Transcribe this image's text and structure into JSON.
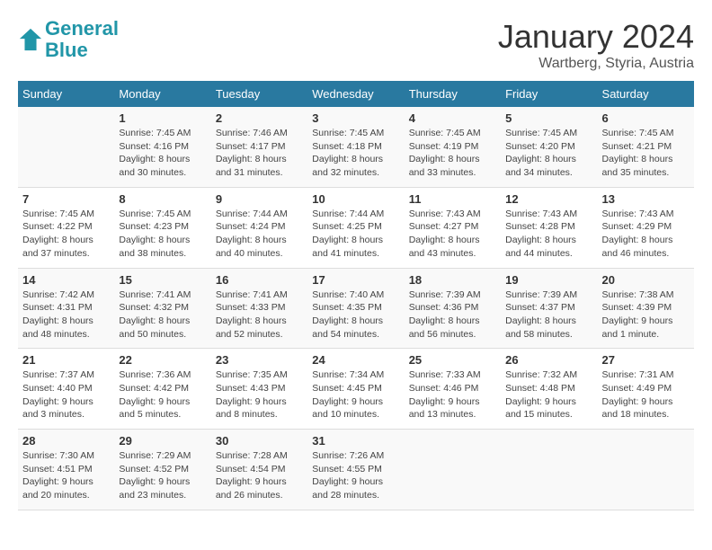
{
  "logo": {
    "line1": "General",
    "line2": "Blue"
  },
  "title": "January 2024",
  "location": "Wartberg, Styria, Austria",
  "weekdays": [
    "Sunday",
    "Monday",
    "Tuesday",
    "Wednesday",
    "Thursday",
    "Friday",
    "Saturday"
  ],
  "weeks": [
    [
      {
        "day": "",
        "sunrise": "",
        "sunset": "",
        "daylight": ""
      },
      {
        "day": "1",
        "sunrise": "Sunrise: 7:45 AM",
        "sunset": "Sunset: 4:16 PM",
        "daylight": "Daylight: 8 hours and 30 minutes."
      },
      {
        "day": "2",
        "sunrise": "Sunrise: 7:46 AM",
        "sunset": "Sunset: 4:17 PM",
        "daylight": "Daylight: 8 hours and 31 minutes."
      },
      {
        "day": "3",
        "sunrise": "Sunrise: 7:45 AM",
        "sunset": "Sunset: 4:18 PM",
        "daylight": "Daylight: 8 hours and 32 minutes."
      },
      {
        "day": "4",
        "sunrise": "Sunrise: 7:45 AM",
        "sunset": "Sunset: 4:19 PM",
        "daylight": "Daylight: 8 hours and 33 minutes."
      },
      {
        "day": "5",
        "sunrise": "Sunrise: 7:45 AM",
        "sunset": "Sunset: 4:20 PM",
        "daylight": "Daylight: 8 hours and 34 minutes."
      },
      {
        "day": "6",
        "sunrise": "Sunrise: 7:45 AM",
        "sunset": "Sunset: 4:21 PM",
        "daylight": "Daylight: 8 hours and 35 minutes."
      }
    ],
    [
      {
        "day": "7",
        "sunrise": "Sunrise: 7:45 AM",
        "sunset": "Sunset: 4:22 PM",
        "daylight": "Daylight: 8 hours and 37 minutes."
      },
      {
        "day": "8",
        "sunrise": "Sunrise: 7:45 AM",
        "sunset": "Sunset: 4:23 PM",
        "daylight": "Daylight: 8 hours and 38 minutes."
      },
      {
        "day": "9",
        "sunrise": "Sunrise: 7:44 AM",
        "sunset": "Sunset: 4:24 PM",
        "daylight": "Daylight: 8 hours and 40 minutes."
      },
      {
        "day": "10",
        "sunrise": "Sunrise: 7:44 AM",
        "sunset": "Sunset: 4:25 PM",
        "daylight": "Daylight: 8 hours and 41 minutes."
      },
      {
        "day": "11",
        "sunrise": "Sunrise: 7:43 AM",
        "sunset": "Sunset: 4:27 PM",
        "daylight": "Daylight: 8 hours and 43 minutes."
      },
      {
        "day": "12",
        "sunrise": "Sunrise: 7:43 AM",
        "sunset": "Sunset: 4:28 PM",
        "daylight": "Daylight: 8 hours and 44 minutes."
      },
      {
        "day": "13",
        "sunrise": "Sunrise: 7:43 AM",
        "sunset": "Sunset: 4:29 PM",
        "daylight": "Daylight: 8 hours and 46 minutes."
      }
    ],
    [
      {
        "day": "14",
        "sunrise": "Sunrise: 7:42 AM",
        "sunset": "Sunset: 4:31 PM",
        "daylight": "Daylight: 8 hours and 48 minutes."
      },
      {
        "day": "15",
        "sunrise": "Sunrise: 7:41 AM",
        "sunset": "Sunset: 4:32 PM",
        "daylight": "Daylight: 8 hours and 50 minutes."
      },
      {
        "day": "16",
        "sunrise": "Sunrise: 7:41 AM",
        "sunset": "Sunset: 4:33 PM",
        "daylight": "Daylight: 8 hours and 52 minutes."
      },
      {
        "day": "17",
        "sunrise": "Sunrise: 7:40 AM",
        "sunset": "Sunset: 4:35 PM",
        "daylight": "Daylight: 8 hours and 54 minutes."
      },
      {
        "day": "18",
        "sunrise": "Sunrise: 7:39 AM",
        "sunset": "Sunset: 4:36 PM",
        "daylight": "Daylight: 8 hours and 56 minutes."
      },
      {
        "day": "19",
        "sunrise": "Sunrise: 7:39 AM",
        "sunset": "Sunset: 4:37 PM",
        "daylight": "Daylight: 8 hours and 58 minutes."
      },
      {
        "day": "20",
        "sunrise": "Sunrise: 7:38 AM",
        "sunset": "Sunset: 4:39 PM",
        "daylight": "Daylight: 9 hours and 1 minute."
      }
    ],
    [
      {
        "day": "21",
        "sunrise": "Sunrise: 7:37 AM",
        "sunset": "Sunset: 4:40 PM",
        "daylight": "Daylight: 9 hours and 3 minutes."
      },
      {
        "day": "22",
        "sunrise": "Sunrise: 7:36 AM",
        "sunset": "Sunset: 4:42 PM",
        "daylight": "Daylight: 9 hours and 5 minutes."
      },
      {
        "day": "23",
        "sunrise": "Sunrise: 7:35 AM",
        "sunset": "Sunset: 4:43 PM",
        "daylight": "Daylight: 9 hours and 8 minutes."
      },
      {
        "day": "24",
        "sunrise": "Sunrise: 7:34 AM",
        "sunset": "Sunset: 4:45 PM",
        "daylight": "Daylight: 9 hours and 10 minutes."
      },
      {
        "day": "25",
        "sunrise": "Sunrise: 7:33 AM",
        "sunset": "Sunset: 4:46 PM",
        "daylight": "Daylight: 9 hours and 13 minutes."
      },
      {
        "day": "26",
        "sunrise": "Sunrise: 7:32 AM",
        "sunset": "Sunset: 4:48 PM",
        "daylight": "Daylight: 9 hours and 15 minutes."
      },
      {
        "day": "27",
        "sunrise": "Sunrise: 7:31 AM",
        "sunset": "Sunset: 4:49 PM",
        "daylight": "Daylight: 9 hours and 18 minutes."
      }
    ],
    [
      {
        "day": "28",
        "sunrise": "Sunrise: 7:30 AM",
        "sunset": "Sunset: 4:51 PM",
        "daylight": "Daylight: 9 hours and 20 minutes."
      },
      {
        "day": "29",
        "sunrise": "Sunrise: 7:29 AM",
        "sunset": "Sunset: 4:52 PM",
        "daylight": "Daylight: 9 hours and 23 minutes."
      },
      {
        "day": "30",
        "sunrise": "Sunrise: 7:28 AM",
        "sunset": "Sunset: 4:54 PM",
        "daylight": "Daylight: 9 hours and 26 minutes."
      },
      {
        "day": "31",
        "sunrise": "Sunrise: 7:26 AM",
        "sunset": "Sunset: 4:55 PM",
        "daylight": "Daylight: 9 hours and 28 minutes."
      },
      {
        "day": "",
        "sunrise": "",
        "sunset": "",
        "daylight": ""
      },
      {
        "day": "",
        "sunrise": "",
        "sunset": "",
        "daylight": ""
      },
      {
        "day": "",
        "sunrise": "",
        "sunset": "",
        "daylight": ""
      }
    ]
  ]
}
